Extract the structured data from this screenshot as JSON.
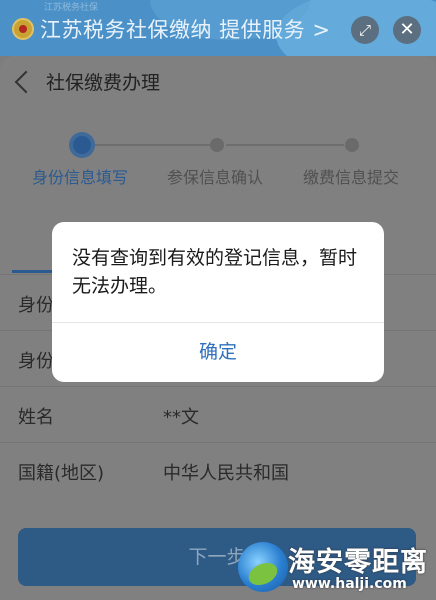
{
  "banner": {
    "title": "江苏税务社保缴纳 提供服务 >",
    "sub": "江苏税务社保"
  },
  "header": {
    "title": "社保缴费办理"
  },
  "steps": [
    {
      "label": "身份信息填写",
      "active": true
    },
    {
      "label": "参保信息确认",
      "active": false
    },
    {
      "label": "缴费信息提交",
      "active": false
    }
  ],
  "form": {
    "rows": [
      {
        "label": "身份",
        "value": ""
      },
      {
        "label": "身份",
        "value": ""
      },
      {
        "label": "姓名",
        "value": "**文"
      },
      {
        "label": "国籍(地区)",
        "value": "中华人民共和国"
      }
    ]
  },
  "next_button": "下一步",
  "dialog": {
    "message": "没有查询到有效的登记信息，暂时无法办理。",
    "confirm": "确定"
  },
  "watermark": {
    "name": "海安零距离",
    "url": "www.halji.com"
  },
  "icons": {
    "expand": "expand-icon",
    "close": "close-icon",
    "back": "back-chevron-icon"
  },
  "colors": {
    "accent": "#2f6fbd",
    "banner": "#4b91c8"
  }
}
